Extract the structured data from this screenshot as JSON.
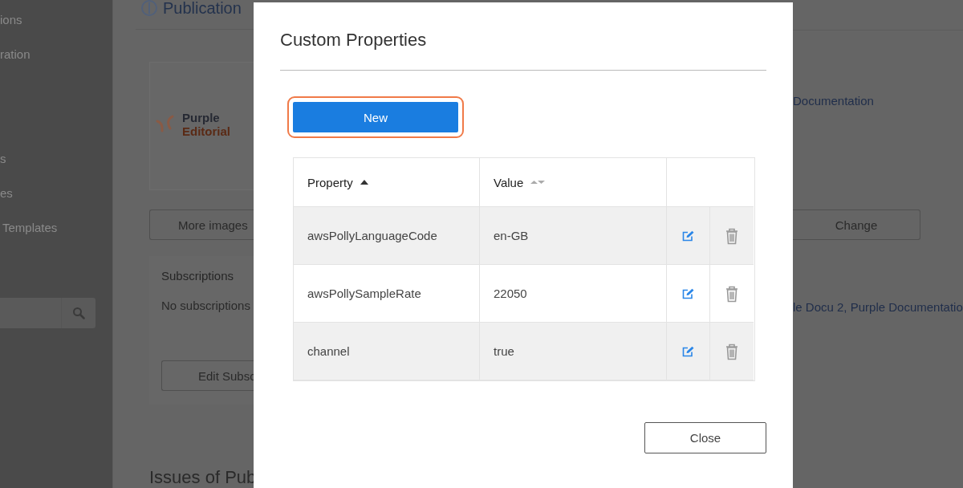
{
  "sidebar": {
    "items": [
      "ions",
      "ration",
      "s",
      "es",
      "Templates"
    ]
  },
  "page": {
    "heading": "Publication",
    "logo": {
      "line_1": "Purple",
      "line_2": "Editorial"
    },
    "more_images_button": "More images",
    "subscriptions": {
      "title": "Subscriptions",
      "text": "No subscriptions",
      "edit_button": "Edit Subsc"
    },
    "issues_heading": "Issues of Pub"
  },
  "right": {
    "link": "Documentation",
    "change_button": "Change",
    "links_text": "le Docu 2, Purple Documentatio"
  },
  "modal": {
    "title": "Custom Properties",
    "new_button": {
      "label": "New",
      "focused": true
    },
    "table": {
      "columns": [
        {
          "label": "Property",
          "sorted": true
        },
        {
          "label": "Value",
          "sorted": false
        }
      ],
      "rows": [
        {
          "property": "awsPollyLanguageCode",
          "value": "en-GB"
        },
        {
          "property": "awsPollySampleRate",
          "value": "22050"
        },
        {
          "property": "channel",
          "value": "true"
        }
      ]
    },
    "close_button": "Close"
  }
}
